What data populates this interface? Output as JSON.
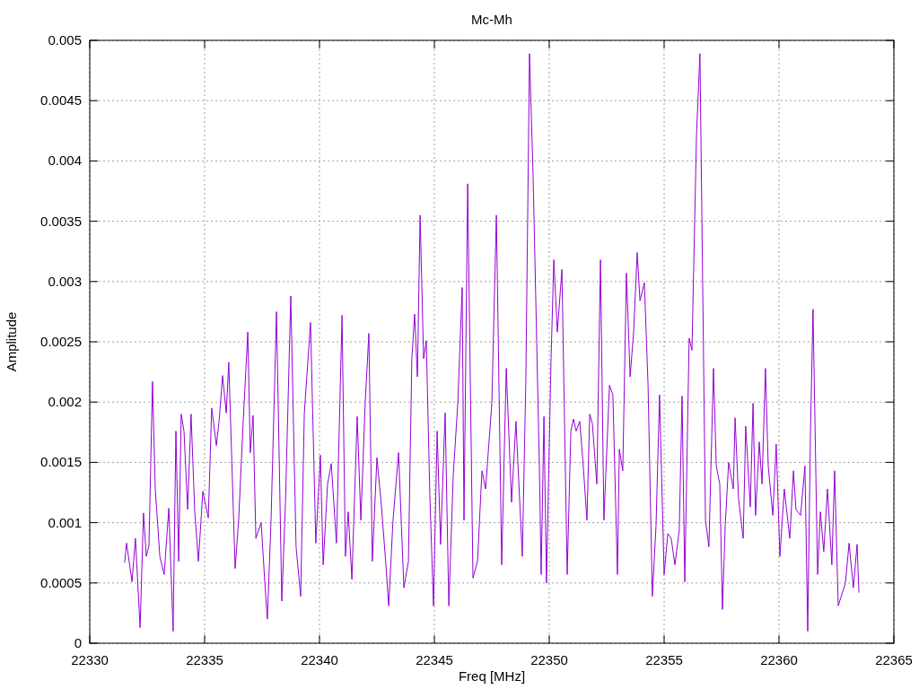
{
  "chart_data": {
    "type": "line",
    "title": "Mc-Mh",
    "xlabel": "Freq [MHz]",
    "ylabel": "Amplitude",
    "xlim": [
      22330,
      22365
    ],
    "ylim": [
      0,
      0.005
    ],
    "xticks": [
      22330,
      22335,
      22340,
      22345,
      22350,
      22355,
      22360,
      22365
    ],
    "yticks": [
      0,
      0.0005,
      0.001,
      0.0015,
      0.002,
      0.0025,
      0.003,
      0.0035,
      0.004,
      0.0045,
      0.005
    ],
    "x": [
      22331.52,
      22331.6,
      22331.84,
      22331.99,
      22332.19,
      22332.34,
      22332.46,
      22332.58,
      22332.73,
      22332.85,
      22333.05,
      22333.24,
      22333.44,
      22333.63,
      22333.75,
      22333.87,
      22333.98,
      22334.1,
      22334.26,
      22334.41,
      22334.57,
      22334.73,
      22334.92,
      22335.16,
      22335.31,
      22335.51,
      22335.63,
      22335.78,
      22335.94,
      22336.05,
      22336.33,
      22336.48,
      22336.68,
      22336.88,
      22336.99,
      22337.11,
      22337.23,
      22337.46,
      22337.62,
      22337.73,
      22337.89,
      22338.13,
      22338.36,
      22338.52,
      22338.75,
      22338.98,
      22339.18,
      22339.34,
      22339.61,
      22339.84,
      22340.04,
      22340.16,
      22340.35,
      22340.51,
      22340.74,
      22340.98,
      22341.13,
      22341.25,
      22341.41,
      22341.64,
      22341.8,
      22341.99,
      22342.15,
      22342.3,
      22342.5,
      22342.7,
      22342.89,
      22343.01,
      22343.2,
      22343.44,
      22343.67,
      22343.87,
      22344.02,
      22344.14,
      22344.26,
      22344.38,
      22344.53,
      22344.65,
      22344.8,
      22344.96,
      22345.12,
      22345.27,
      22345.47,
      22345.63,
      22345.82,
      22346.02,
      22346.21,
      22346.29,
      22346.45,
      22346.68,
      22346.88,
      22347.07,
      22347.23,
      22347.5,
      22347.7,
      22347.93,
      22348.13,
      22348.36,
      22348.55,
      22348.83,
      22348.98,
      22349.14,
      22349.3,
      22349.57,
      22349.65,
      22349.77,
      22349.88,
      22350.08,
      22350.2,
      22350.35,
      22350.55,
      22350.78,
      22350.94,
      22351.05,
      22351.17,
      22351.33,
      22351.48,
      22351.64,
      22351.76,
      22351.88,
      22352.07,
      22352.23,
      22352.38,
      22352.62,
      22352.77,
      22352.97,
      22353.05,
      22353.2,
      22353.36,
      22353.52,
      22353.67,
      22353.83,
      22353.95,
      22354.14,
      22354.3,
      22354.49,
      22354.65,
      22354.8,
      22355.0,
      22355.16,
      22355.31,
      22355.47,
      22355.66,
      22355.78,
      22355.9,
      22356.09,
      22356.21,
      22356.41,
      22356.56,
      22356.8,
      22356.95,
      22357.15,
      22357.27,
      22357.42,
      22357.54,
      22357.66,
      22357.81,
      22358.01,
      22358.09,
      22358.24,
      22358.44,
      22358.55,
      22358.75,
      22358.87,
      22358.98,
      22359.14,
      22359.26,
      22359.41,
      22359.53,
      22359.73,
      22359.88,
      22360.04,
      22360.23,
      22360.47,
      22360.63,
      22360.74,
      22360.94,
      22361.13,
      22361.25,
      22361.37,
      22361.48,
      22361.68,
      22361.8,
      22361.95,
      22362.11,
      22362.3,
      22362.42,
      22362.58,
      22362.89,
      22363.05,
      22363.24,
      22363.4,
      22363.48
    ],
    "grid": true,
    "series": [
      {
        "color": "#9400d3",
        "values": [
          0.00067,
          0.00083,
          0.00051,
          0.00087,
          0.00013,
          0.00108,
          0.00072,
          0.00081,
          0.00217,
          0.00128,
          0.00072,
          0.00057,
          0.00112,
          0.0001,
          0.00176,
          0.00068,
          0.0019,
          0.00176,
          0.00111,
          0.0019,
          0.00109,
          0.00068,
          0.00126,
          0.00104,
          0.00195,
          0.00164,
          0.00184,
          0.00222,
          0.00191,
          0.00233,
          0.00062,
          0.00102,
          0.00184,
          0.00258,
          0.00158,
          0.00189,
          0.00087,
          0.001,
          0.0005,
          0.0002,
          0.00102,
          0.00275,
          0.00035,
          0.00117,
          0.00288,
          0.0008,
          0.00039,
          0.00191,
          0.00266,
          0.00083,
          0.00156,
          0.00065,
          0.00132,
          0.00149,
          0.00083,
          0.00272,
          0.00072,
          0.00109,
          0.00053,
          0.00188,
          0.00102,
          0.00199,
          0.00257,
          0.00068,
          0.00154,
          0.00113,
          0.00065,
          0.00031,
          0.00102,
          0.00158,
          0.00046,
          0.00068,
          0.00236,
          0.00273,
          0.00221,
          0.00355,
          0.00236,
          0.00251,
          0.00124,
          0.00031,
          0.00176,
          0.00082,
          0.00191,
          0.00031,
          0.00139,
          0.00199,
          0.00295,
          0.00102,
          0.00381,
          0.00054,
          0.00068,
          0.00143,
          0.00128,
          0.00199,
          0.00355,
          0.00065,
          0.00228,
          0.00117,
          0.00184,
          0.00072,
          0.00217,
          0.00489,
          0.00385,
          0.00147,
          0.00057,
          0.00188,
          0.0005,
          0.00236,
          0.00318,
          0.00258,
          0.0031,
          0.00057,
          0.00176,
          0.00186,
          0.00176,
          0.00184,
          0.00147,
          0.00102,
          0.0019,
          0.00182,
          0.00132,
          0.00318,
          0.00102,
          0.00214,
          0.00206,
          0.00057,
          0.00161,
          0.00143,
          0.00307,
          0.00221,
          0.00258,
          0.00324,
          0.00284,
          0.00299,
          0.00214,
          0.00039,
          0.00098,
          0.00206,
          0.00057,
          0.00091,
          0.00087,
          0.00065,
          0.00094,
          0.00205,
          0.00051,
          0.00253,
          0.00243,
          0.00422,
          0.00489,
          0.00102,
          0.0008,
          0.00228,
          0.00147,
          0.00132,
          0.00028,
          0.00098,
          0.0015,
          0.00128,
          0.00187,
          0.0012,
          0.00087,
          0.0018,
          0.00113,
          0.00199,
          0.00106,
          0.00167,
          0.00132,
          0.00228,
          0.00147,
          0.00106,
          0.00165,
          0.00072,
          0.00128,
          0.00087,
          0.00143,
          0.00111,
          0.00106,
          0.00147,
          0.0001,
          0.00176,
          0.00277,
          0.00057,
          0.00109,
          0.00076,
          0.00128,
          0.00065,
          0.00143,
          0.00031,
          0.0005,
          0.00083,
          0.00046,
          0.00082,
          0.00042
        ]
      }
    ]
  }
}
